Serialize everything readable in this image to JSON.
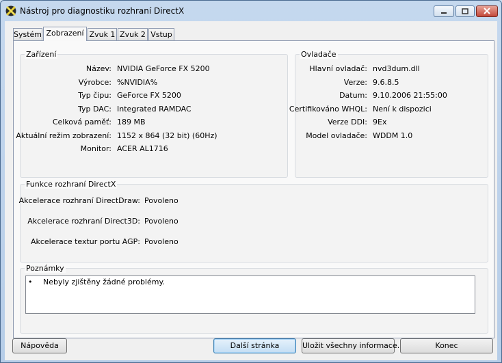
{
  "window": {
    "title": "Nástroj pro diagnostiku rozhraní DirectX"
  },
  "tabs": [
    {
      "label": "Systém"
    },
    {
      "label": "Zobrazení",
      "active": true
    },
    {
      "label": "Zvuk 1"
    },
    {
      "label": "Zvuk 2"
    },
    {
      "label": "Vstup"
    }
  ],
  "device": {
    "title": "Zařízení",
    "rows": [
      {
        "label": "Název:",
        "value": "NVIDIA GeForce FX 5200"
      },
      {
        "label": "Výrobce:",
        "value": "%NVIDIA%"
      },
      {
        "label": "Typ čipu:",
        "value": "GeForce FX 5200"
      },
      {
        "label": "Typ DAC:",
        "value": "Integrated RAMDAC"
      },
      {
        "label": "Celková paměť:",
        "value": "189 MB"
      },
      {
        "label": "Aktuální režim zobrazení:",
        "value": "1152 x 864 (32 bit) (60Hz)"
      },
      {
        "label": "Monitor:",
        "value": "ACER AL1716"
      }
    ]
  },
  "drivers": {
    "title": "Ovladače",
    "rows": [
      {
        "label": "Hlavní ovladač:",
        "value": "nvd3dum.dll"
      },
      {
        "label": "Verze:",
        "value": "9.6.8.5"
      },
      {
        "label": "Datum:",
        "value": "9.10.2006 21:55:00"
      },
      {
        "label": "Certifikováno WHQL:",
        "value": "Není k dispozici"
      },
      {
        "label": "Verze DDI:",
        "value": "9Ex"
      },
      {
        "label": "Model ovladače:",
        "value": "WDDM 1.0"
      }
    ]
  },
  "features": {
    "title": "Funkce rozhraní DirectX",
    "rows": [
      {
        "label": "Akcelerace rozhraní DirectDraw:",
        "value": "Povoleno"
      },
      {
        "label": "Akcelerace rozhraní Direct3D:",
        "value": "Povoleno"
      },
      {
        "label": "Akcelerace textur portu AGP:",
        "value": "Povoleno"
      }
    ]
  },
  "notes": {
    "title": "Poznámky",
    "bullet": "•",
    "items": [
      "Nebyly zjištěny žádné problémy."
    ]
  },
  "buttons": {
    "help": "Nápověda",
    "next_page": "Další stránka",
    "save_all": "Uložit všechny informace...",
    "exit": "Konec"
  }
}
